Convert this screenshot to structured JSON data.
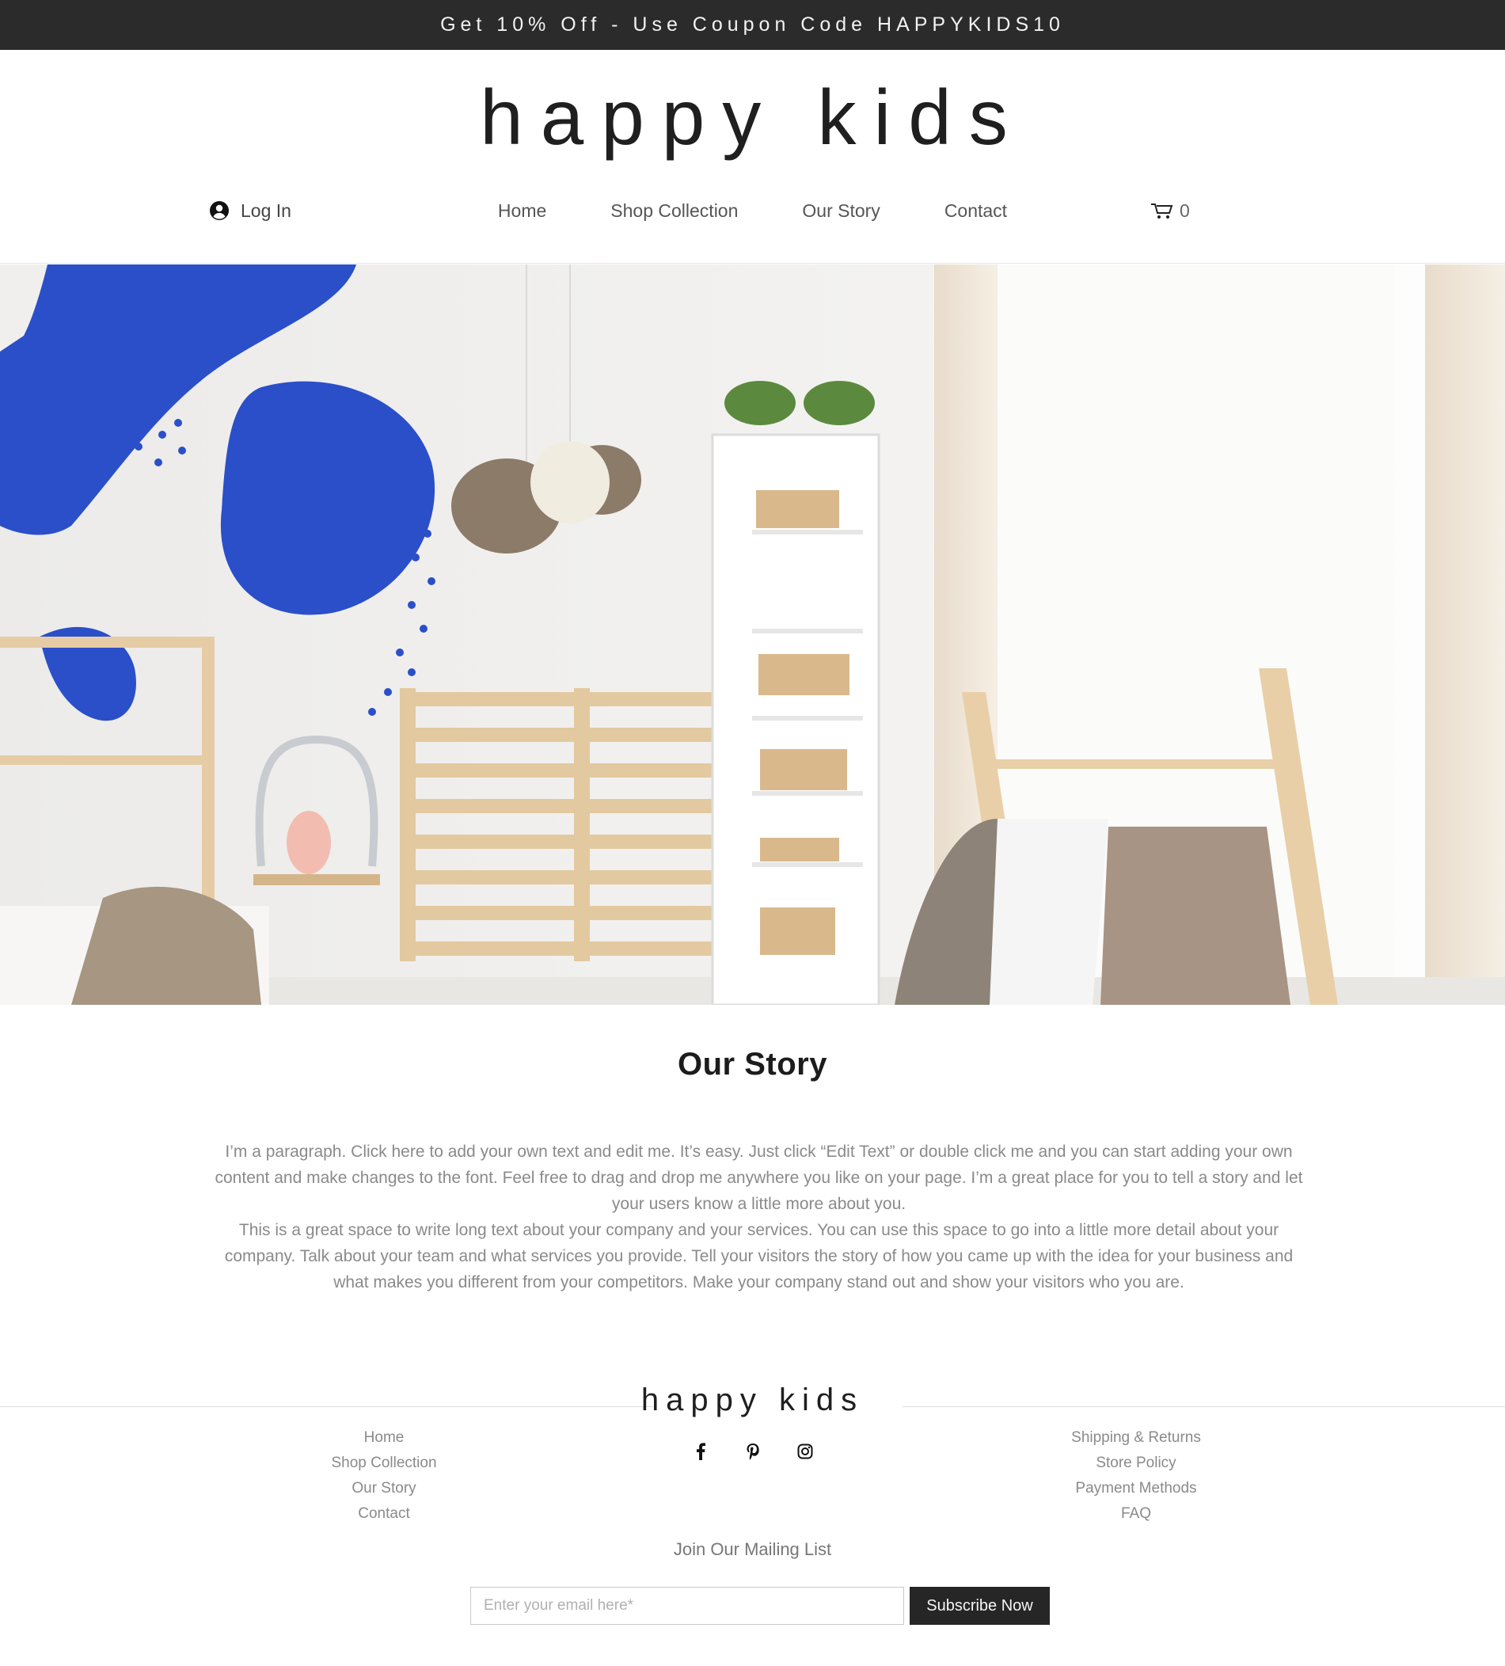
{
  "promo": {
    "text": "Get 10% Off - Use Coupon Code HAPPYKIDS10"
  },
  "header": {
    "brand": "happy kids",
    "login_label": "Log In",
    "nav": [
      "Home",
      "Shop Collection",
      "Our Story",
      "Contact"
    ],
    "cart_count": "0"
  },
  "hero": {
    "image": "kids-room-photo"
  },
  "story": {
    "title": "Our Story",
    "paragraph_1": "I’m a paragraph. Click here to add your own text and edit me. It’s easy. Just click “Edit Text” or double click me and you can start adding your own content and make changes to the font. Feel free to drag and drop me anywhere you like on your page. I’m a great place for you to tell a story and let your users know a little more about you.",
    "paragraph_2": "This is a great space to write long text about your company and your services. You can use this space to go into a little more detail about your company. Talk about your team and what services you provide. Tell your visitors the story of how you came up with the idea for your business and what makes you different from your competitors. Make your company stand out and show your visitors who you are."
  },
  "footer": {
    "brand": "happy kids",
    "left_links": [
      "Home",
      "Shop Collection",
      "Our Story",
      "Contact"
    ],
    "right_links": [
      "Shipping & Returns",
      "Store Policy",
      "Payment Methods",
      "FAQ"
    ],
    "socials": [
      "facebook-icon",
      "pinterest-icon",
      "instagram-icon"
    ],
    "mailing_title": "Join Our Mailing List",
    "email_placeholder": "Enter your email here*",
    "subscribe_label": "Subscribe Now"
  },
  "colors": {
    "promo_bg": "#2b2b2b",
    "accent_blue": "#2a4fc9",
    "button_bg": "#262626"
  }
}
